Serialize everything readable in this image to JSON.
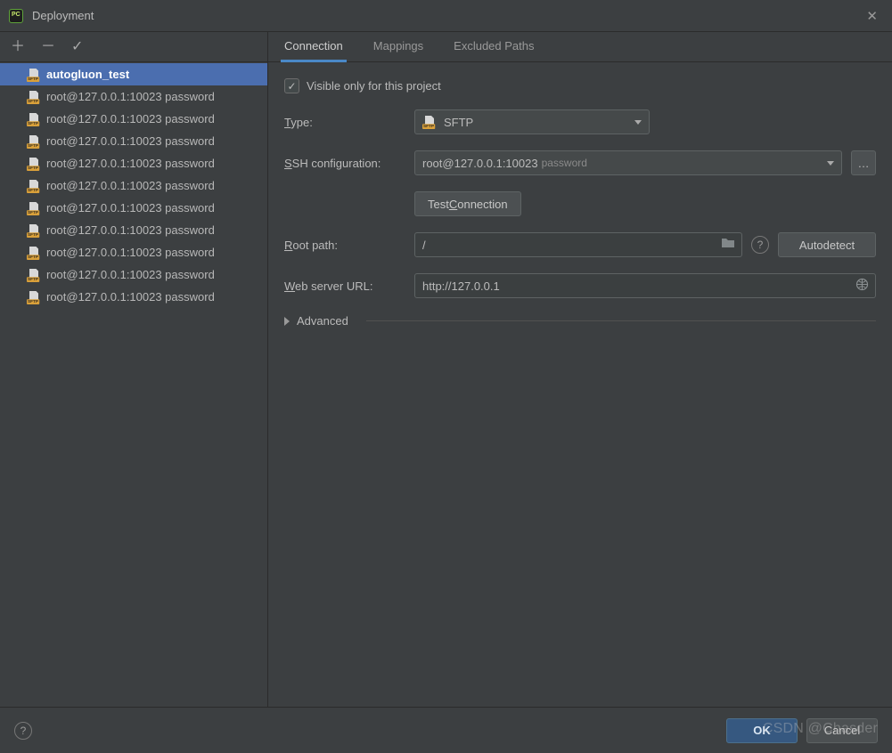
{
  "window": {
    "title": "Deployment"
  },
  "sidebar": {
    "items": [
      {
        "label": "autogluon_test",
        "selected": true
      },
      {
        "label": "root@127.0.0.1:10023 password",
        "selected": false
      },
      {
        "label": "root@127.0.0.1:10023 password",
        "selected": false
      },
      {
        "label": "root@127.0.0.1:10023 password",
        "selected": false
      },
      {
        "label": "root@127.0.0.1:10023 password",
        "selected": false
      },
      {
        "label": "root@127.0.0.1:10023 password",
        "selected": false
      },
      {
        "label": "root@127.0.0.1:10023 password",
        "selected": false
      },
      {
        "label": "root@127.0.0.1:10023 password",
        "selected": false
      },
      {
        "label": "root@127.0.0.1:10023 password",
        "selected": false
      },
      {
        "label": "root@127.0.0.1:10023 password",
        "selected": false
      },
      {
        "label": "root@127.0.0.1:10023 password",
        "selected": false
      }
    ]
  },
  "tabs": {
    "connection": "Connection",
    "mappings": "Mappings",
    "excluded": "Excluded Paths",
    "active": "connection"
  },
  "form": {
    "visible_only": {
      "label": "Visible only for this project",
      "checked": true
    },
    "type": {
      "label_pre": "T",
      "label_post": "ype:",
      "value": "SFTP"
    },
    "ssh": {
      "label_pre": "S",
      "label_post": "SH configuration:",
      "value": "root@127.0.0.1:10023",
      "auth": "password"
    },
    "test_connection": {
      "pre": "Test ",
      "ul": "C",
      "post": "onnection"
    },
    "root_path": {
      "label_pre": "R",
      "label_post": "oot path:",
      "value": "/"
    },
    "autodetect": "Autodetect",
    "web_url": {
      "label_pre": "W",
      "label_post": "eb server URL:",
      "value": "http://127.0.0.1"
    },
    "advanced": "Advanced"
  },
  "footer": {
    "ok": "OK",
    "cancel": "Cancel"
  },
  "watermark": "CSDN @Chasder"
}
